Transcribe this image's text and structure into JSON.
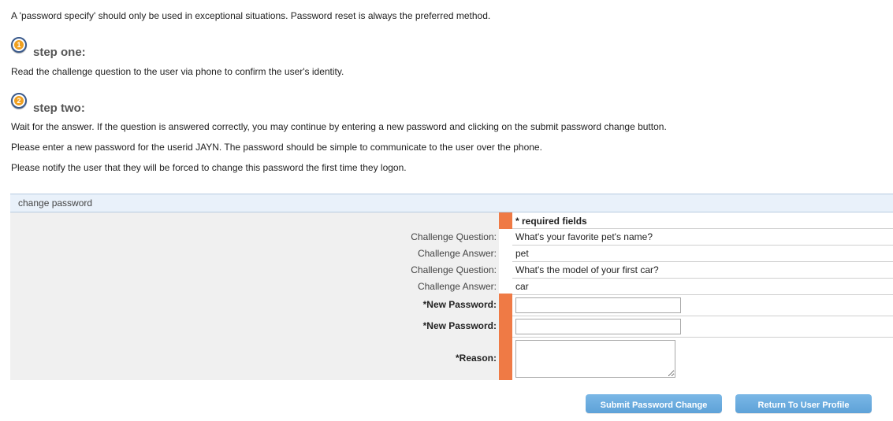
{
  "intro": "A 'password specify' should only be used in exceptional situations. Password reset is always the preferred method.",
  "steps": [
    {
      "number": "1",
      "title": "step one:",
      "paragraphs": [
        "Read the challenge question to the user via phone to confirm the user's identity."
      ]
    },
    {
      "number": "2",
      "title": "step two:",
      "paragraphs": [
        "Wait for the answer. If the question is answered correctly, you may continue by entering a new password and clicking on the submit password change button.",
        "Please enter a new password for the userid JAYN. The password should be simple to communicate to the user over the phone.",
        "Please notify the user that they will be forced to change this password the first time they logon."
      ]
    }
  ],
  "panel": {
    "title": "change password",
    "required_note": "* required fields",
    "rows": [
      {
        "label": "Challenge Question:",
        "value": "What's your favorite pet's name?"
      },
      {
        "label": "Challenge Answer:",
        "value": "pet"
      },
      {
        "label": "Challenge Question:",
        "value": "What's the model of your first car?"
      },
      {
        "label": "Challenge Answer:",
        "value": "car"
      }
    ],
    "fields": {
      "new_password_1": {
        "label": "*New Password:",
        "value": ""
      },
      "new_password_2": {
        "label": "*New Password:",
        "value": ""
      },
      "reason": {
        "label": "*Reason:",
        "value": ""
      }
    }
  },
  "buttons": {
    "submit": "Submit Password Change",
    "return": "Return To User Profile"
  },
  "colors": {
    "required_marker": "#ef7a45",
    "button": "#5ea2d8",
    "panel_header": "#e9f1fa",
    "label_background": "#f0f0f0"
  }
}
